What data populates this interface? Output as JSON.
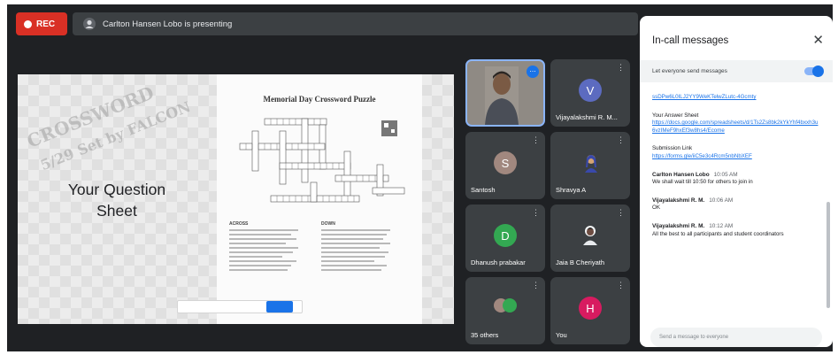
{
  "top_bar": {
    "rec_label": "REC",
    "presenting_text": "Carlton Hansen Lobo is presenting"
  },
  "shared_screen": {
    "watermark_line1": "CROSSWORD",
    "watermark_line2": "5/29 Set by FALCON",
    "left_text_line1": "Your Question",
    "left_text_line2": "Sheet",
    "puzzle_title": "Memorial Day Crossword Puzzle",
    "across_heading": "ACROSS",
    "down_heading": "DOWN"
  },
  "tiles": [
    {
      "name": "Vijayalakshmi R. M...",
      "initial": "V",
      "color": "#5c6bc0"
    },
    {
      "name": "Santosh",
      "initial": "S",
      "color": "#a1887f"
    },
    {
      "name": "Shravya A",
      "initial": "",
      "color": ""
    },
    {
      "name": "Dhanush prabakar",
      "initial": "D",
      "color": "#33a852"
    },
    {
      "name": "Jaia B Cheriyath",
      "initial": "",
      "color": ""
    },
    {
      "name": "35 others",
      "initial": "",
      "color": ""
    },
    {
      "name": "You",
      "initial": "H",
      "color": "#d81b60"
    }
  ],
  "chat": {
    "title": "In-call messages",
    "setting_label": "Let everyone send messages",
    "link_top": "ssDPw6L0ILJ2YY9WeKTelwZLutc-4Gcmty",
    "answer_label": "Your Answer Sheet",
    "answer_link": "https://docs.google.com/spreadsheets/d/1Ts2Zs8bk2kYkYhf4bxxh3u6vzIMeF9hxEf3w8hs4/Ecome",
    "submission_label": "Submission Link",
    "submission_link": "https://forms.gle/iiC5e3c4Rcm5nbNbXEF",
    "messages": [
      {
        "sender": "Carlton Hansen Lobo",
        "time": "10:05 AM",
        "text": "We shall wait till 10:50 for others to join in"
      },
      {
        "sender": "Vijayalakshmi R. M.",
        "time": "10:06 AM",
        "text": "OK"
      },
      {
        "sender": "Vijayalakshmi R. M.",
        "time": "10:12 AM",
        "text": "All the best to all participants and student coordinators"
      }
    ],
    "input_placeholder": "Send a message to everyone"
  }
}
